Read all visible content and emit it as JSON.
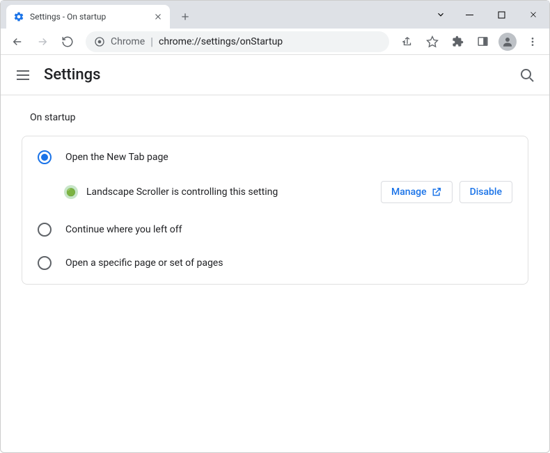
{
  "window": {
    "tab_title": "Settings - On startup"
  },
  "omnibox": {
    "prefix": "Chrome",
    "url": "chrome://settings/onStartup"
  },
  "settings": {
    "title": "Settings",
    "section": "On startup",
    "options": {
      "newtab": "Open the New Tab page",
      "continue": "Continue where you left off",
      "specific": "Open a specific page or set of pages"
    },
    "extension": {
      "message": "Landscape Scroller is controlling this setting",
      "manage": "Manage",
      "disable": "Disable"
    }
  }
}
